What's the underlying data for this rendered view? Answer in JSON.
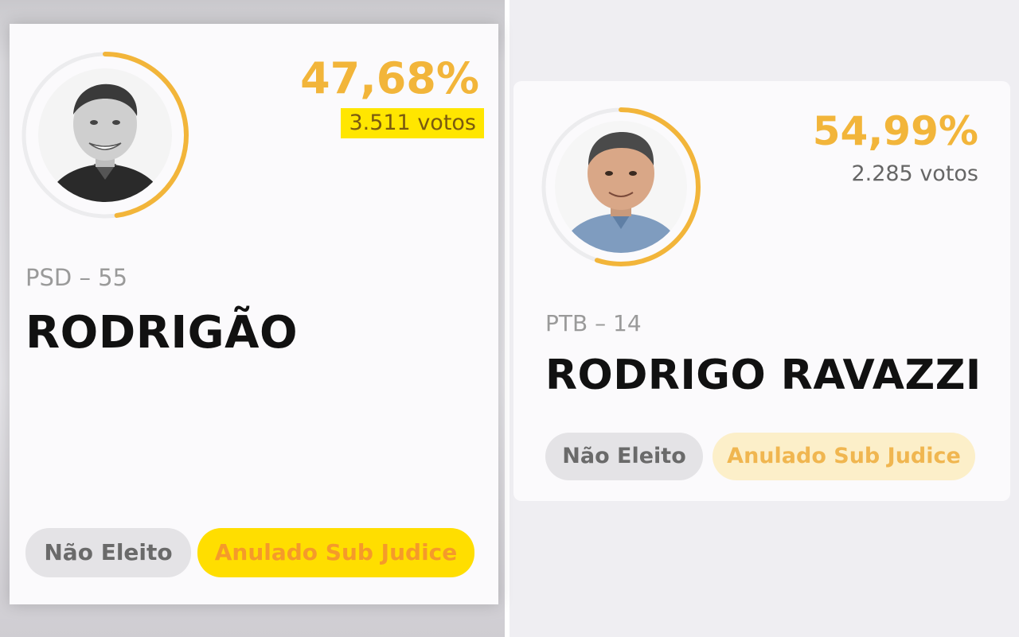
{
  "candidates": [
    {
      "percent": "47,68%",
      "votes": "3.511 votos",
      "party": "PSD – 55",
      "name": "RODRIGÃO",
      "status_result": "Não Eleito",
      "status_legal": "Anulado Sub Judice",
      "photo": "candidate-photo-bw",
      "ring_fraction": 0.4768
    },
    {
      "percent": "54,99%",
      "votes": "2.285 votos",
      "party": "PTB – 14",
      "name": "RODRIGO RAVAZZI",
      "status_result": "Não Eleito",
      "status_legal": "Anulado Sub Judice",
      "photo": "candidate-photo-color",
      "ring_fraction": 0.5499
    }
  ],
  "colors": {
    "accent": "#f2b53a",
    "highlight": "#ffe600",
    "pill_gray": "#e4e3e6"
  }
}
